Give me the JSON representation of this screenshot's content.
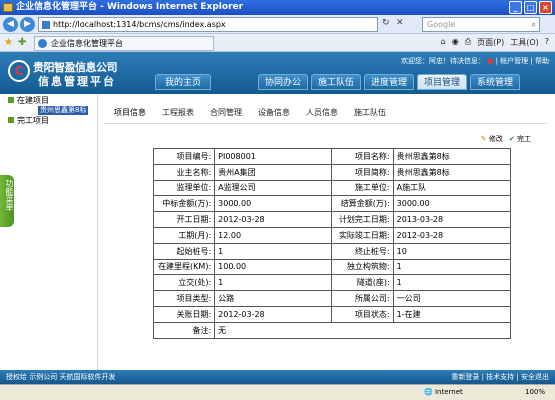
{
  "window": {
    "title": "企业信息化管理平台 - Windows Internet Explorer"
  },
  "browser": {
    "url": "http://localhost:1314/bcms/cms/index.aspx",
    "search_placeholder": "Google",
    "tab_title": "企业信息化管理平台",
    "tools": [
      "页面(P)",
      "工具(O)",
      "?"
    ]
  },
  "header": {
    "logo_top": "贵阳智盈信息公司",
    "logo_bottom": "信息管理平台",
    "welcome": "欢迎您：阿忠！待决信息：",
    "welcome_links": [
      "帐户管理",
      "帮助"
    ],
    "nav": [
      {
        "label": "我的主页",
        "active": false
      },
      {
        "label": "协同办公",
        "active": false
      },
      {
        "label": "施工队伍",
        "active": false
      },
      {
        "label": "进度管理",
        "active": false
      },
      {
        "label": "项目管理",
        "active": true
      },
      {
        "label": "系统管理",
        "active": false
      }
    ]
  },
  "sidebar": {
    "items": [
      "在建项目",
      "完工项目"
    ],
    "sub_item": "贵州思鑫第8标",
    "func_tab": "功能菜单"
  },
  "subnav": [
    "项目信息",
    "工程报表",
    "合同管理",
    "设备信息",
    "人员信息",
    "施工队伍"
  ],
  "actions": {
    "edit": "修改",
    "done": "完工"
  },
  "project": {
    "rows": [
      [
        "项目编号:",
        "PI008001",
        "项目名称:",
        "贵州思鑫第8标"
      ],
      [
        "业主名称:",
        "贵州A集团",
        "项目简称:",
        "贵州思鑫第8标"
      ],
      [
        "监理单位:",
        "A监理公司",
        "施工单位:",
        "A施工队"
      ],
      [
        "中标金额(万):",
        "3000.00",
        "结算金额(万):",
        "3000.00"
      ],
      [
        "开工日期:",
        "2012-03-28",
        "计划完工日期:",
        "2013-03-28"
      ],
      [
        "工期(月):",
        "12.00",
        "实际竣工日期:",
        "2012-03-28"
      ],
      [
        "起始桩号:",
        "1",
        "终止桩号:",
        "10"
      ],
      [
        "在建里程(KM):",
        "100.00",
        "独立构筑物:",
        "1"
      ],
      [
        "立交(处):",
        "1",
        "隧道(座):",
        "1"
      ],
      [
        "项目类型:",
        "公路",
        "所属公司:",
        "一公司"
      ],
      [
        "关账日期:",
        "2012-03-28",
        "项目状态:",
        "1-在建"
      ]
    ],
    "notes_label": "备注:",
    "notes_value": "无"
  },
  "footer": {
    "left": "授权给 示例公司  天航国际软件开发",
    "right": "重新登录 | 技术支持 | 安全退出"
  },
  "status": {
    "zone": "Internet",
    "zoom": "100%"
  }
}
